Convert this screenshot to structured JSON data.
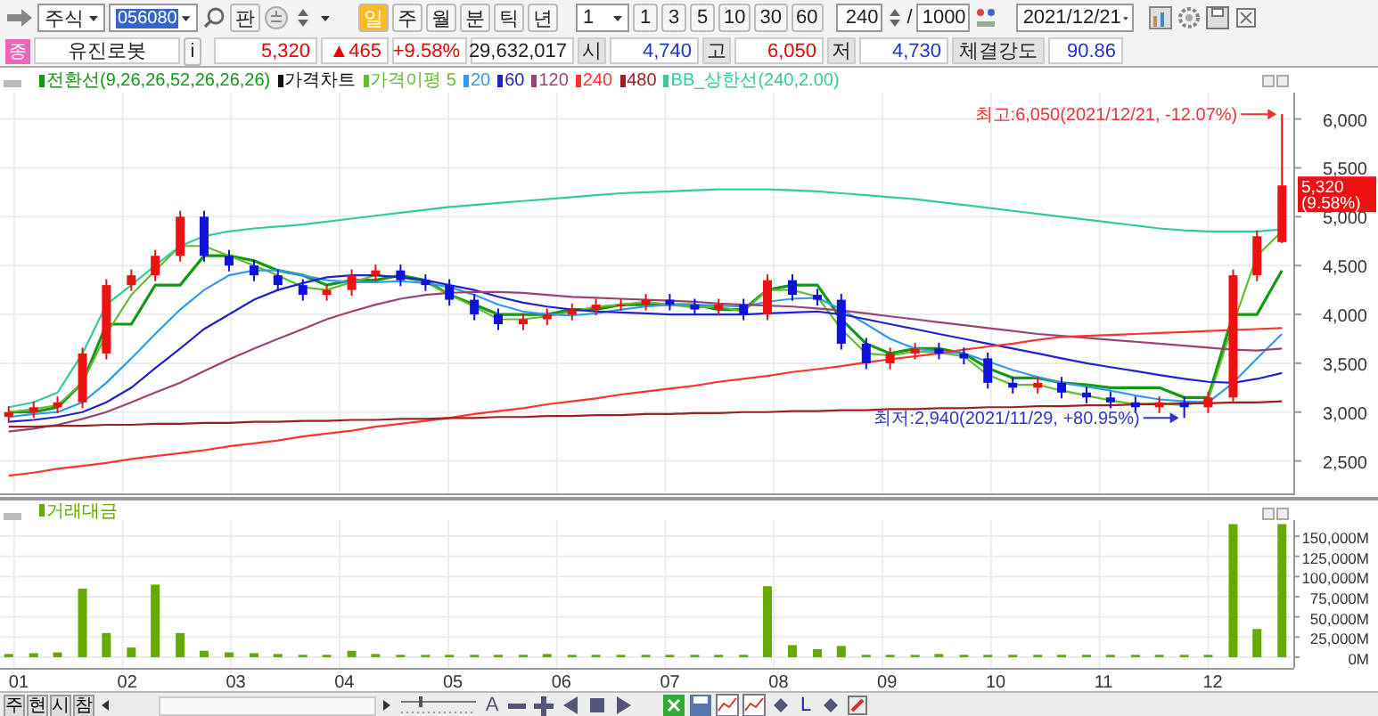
{
  "toolbar": {
    "market": "주식",
    "code": "056080",
    "chart_button": "판",
    "period_tabs": [
      {
        "label": "일",
        "selected": true
      },
      {
        "label": "주",
        "selected": false
      },
      {
        "label": "월",
        "selected": false
      },
      {
        "label": "분",
        "selected": false
      },
      {
        "label": "틱",
        "selected": false
      },
      {
        "label": "년",
        "selected": false
      }
    ],
    "interval": "1",
    "interval_buttons": [
      "1",
      "3",
      "5",
      "10",
      "30",
      "60"
    ],
    "count": "240",
    "separator": "/",
    "total": "1000",
    "date": "2021/12/21"
  },
  "quote": {
    "badge": "종",
    "name": "유진로봇",
    "info": "i",
    "price": "5,320",
    "change": "▲465",
    "rate": "+9.58%",
    "volume": "29,632,017",
    "fields": [
      {
        "label": "시",
        "value": "4,740",
        "color": "#2233cc"
      },
      {
        "label": "고",
        "value": "6,050",
        "color": "#ee0000"
      },
      {
        "label": "저",
        "value": "4,730",
        "color": "#2233cc"
      },
      {
        "label": "체결강도",
        "value": "90.86",
        "color": "#2233cc"
      }
    ]
  },
  "price_chart": {
    "candle_label": "가격차트",
    "last_price": "5,320",
    "last_rate": "(9.58%)",
    "chart_data": {
      "type": "candlestick",
      "grid": true,
      "x": [
        0.95,
        1.18,
        1.4,
        1.63,
        1.85,
        2.08,
        2.3,
        2.53,
        2.75,
        2.98,
        3.21,
        3.43,
        3.66,
        3.88,
        4.11,
        4.33,
        4.56,
        4.79,
        5.01,
        5.24,
        5.46,
        5.69,
        5.91,
        6.14,
        6.36,
        6.59,
        6.82,
        7.04,
        7.27,
        7.49,
        7.72,
        7.94,
        8.17,
        8.4,
        8.62,
        8.85,
        9.07,
        9.3,
        9.52,
        9.75,
        9.97,
        10.2,
        10.43,
        10.65,
        10.88,
        11.1,
        11.33,
        11.55,
        11.78,
        12.0,
        12.23,
        12.45,
        12.68
      ],
      "xlim": [
        0.87,
        12.76
      ],
      "ylim": [
        2150,
        6270
      ],
      "yticks": [
        {
          "value": 2500,
          "label": "2,500"
        },
        {
          "value": 3000,
          "label": "3,000"
        },
        {
          "value": 3500,
          "label": "3,500"
        },
        {
          "value": 4000,
          "label": "4,000"
        },
        {
          "value": 4500,
          "label": "4,500"
        },
        {
          "value": 5000,
          "label": "5,000"
        },
        {
          "value": 5500,
          "label": "5,500"
        },
        {
          "value": 6000,
          "label": "6,000"
        }
      ],
      "ohlc": [
        [
          2950,
          3060,
          2890,
          3000
        ],
        [
          3000,
          3110,
          2940,
          3050
        ],
        [
          3050,
          3160,
          2990,
          3100
        ],
        [
          3100,
          3660,
          3040,
          3600
        ],
        [
          3600,
          4360,
          3540,
          4300
        ],
        [
          4300,
          4460,
          4240,
          4400
        ],
        [
          4400,
          4660,
          4340,
          4600
        ],
        [
          4600,
          5060,
          4540,
          5000
        ],
        [
          5000,
          5060,
          4540,
          4600
        ],
        [
          4600,
          4660,
          4440,
          4500
        ],
        [
          4500,
          4560,
          4340,
          4400
        ],
        [
          4400,
          4460,
          4240,
          4300
        ],
        [
          4300,
          4360,
          4140,
          4200
        ],
        [
          4200,
          4310,
          4140,
          4250
        ],
        [
          4250,
          4460,
          4190,
          4400
        ],
        [
          4400,
          4510,
          4340,
          4450
        ],
        [
          4450,
          4510,
          4290,
          4350
        ],
        [
          4350,
          4410,
          4240,
          4300
        ],
        [
          4300,
          4360,
          4090,
          4150
        ],
        [
          4150,
          4210,
          3940,
          4000
        ],
        [
          4000,
          4060,
          3840,
          3900
        ],
        [
          3900,
          4010,
          3840,
          3950
        ],
        [
          3950,
          4060,
          3890,
          4000
        ],
        [
          4000,
          4110,
          3940,
          4050
        ],
        [
          4050,
          4160,
          3990,
          4100
        ],
        [
          4100,
          4160,
          4040,
          4100
        ],
        [
          4100,
          4210,
          4040,
          4150
        ],
        [
          4150,
          4210,
          4040,
          4100
        ],
        [
          4100,
          4160,
          3990,
          4050
        ],
        [
          4050,
          4160,
          3990,
          4100
        ],
        [
          4100,
          4160,
          3940,
          4000
        ],
        [
          4000,
          4410,
          3940,
          4350
        ],
        [
          4350,
          4410,
          4140,
          4200
        ],
        [
          4200,
          4260,
          4090,
          4150
        ],
        [
          4150,
          4210,
          3640,
          3700
        ],
        [
          3700,
          3760,
          3440,
          3500
        ],
        [
          3500,
          3660,
          3440,
          3600
        ],
        [
          3600,
          3710,
          3540,
          3650
        ],
        [
          3650,
          3710,
          3540,
          3600
        ],
        [
          3600,
          3660,
          3490,
          3550
        ],
        [
          3550,
          3610,
          3240,
          3300
        ],
        [
          3300,
          3360,
          3190,
          3250
        ],
        [
          3250,
          3360,
          3190,
          3300
        ],
        [
          3300,
          3360,
          3140,
          3200
        ],
        [
          3200,
          3260,
          3090,
          3150
        ],
        [
          3150,
          3210,
          3040,
          3100
        ],
        [
          3100,
          3160,
          2990,
          3050
        ],
        [
          3050,
          3160,
          2990,
          3100
        ],
        [
          3100,
          3160,
          2940,
          3050
        ],
        [
          3050,
          3210,
          2990,
          3150
        ],
        [
          3150,
          4460,
          3090,
          4400
        ],
        [
          4400,
          4860,
          4340,
          4800
        ],
        [
          4740,
          6050,
          4730,
          5320
        ]
      ],
      "series": [
        {
          "name": "전환선(9,26,26,52,26,26,26)",
          "type": "line",
          "color": "#119911",
          "values": [
            3000,
            3000,
            3050,
            3300,
            3900,
            3900,
            4300,
            4300,
            4600,
            4600,
            4550,
            4450,
            4400,
            4300,
            4350,
            4350,
            4400,
            4350,
            4200,
            4100,
            4000,
            4000,
            4000,
            4050,
            4050,
            4100,
            4100,
            4100,
            4100,
            4050,
            4050,
            4250,
            4300,
            4300,
            3950,
            3700,
            3600,
            3650,
            3650,
            3600,
            3450,
            3350,
            3350,
            3300,
            3280,
            3250,
            3250,
            3250,
            3150,
            3150,
            4000,
            4000,
            4450
          ]
        },
        {
          "name": "가격이평 5",
          "type": "line",
          "color": "#66bb33",
          "values": [
            3000,
            3030,
            3070,
            3300,
            3800,
            4200,
            4450,
            4700,
            4700,
            4600,
            4500,
            4400,
            4280,
            4250,
            4330,
            4400,
            4380,
            4330,
            4200,
            4080,
            3950,
            3950,
            3980,
            4030,
            4080,
            4100,
            4130,
            4100,
            4070,
            4080,
            4030,
            4250,
            4250,
            4180,
            3850,
            3600,
            3580,
            3620,
            3610,
            3570,
            3380,
            3280,
            3280,
            3220,
            3170,
            3120,
            3080,
            3090,
            3070,
            3120,
            3900,
            4600,
            4850
          ]
        },
        {
          "name": "20",
          "type": "line",
          "color": "#3399ee",
          "values": [
            2950,
            2980,
            3000,
            3100,
            3300,
            3550,
            3800,
            4050,
            4250,
            4400,
            4450,
            4450,
            4400,
            4350,
            4330,
            4330,
            4340,
            4320,
            4280,
            4200,
            4100,
            4030,
            4000,
            3990,
            4010,
            4050,
            4080,
            4100,
            4100,
            4090,
            4080,
            4130,
            4160,
            4170,
            4050,
            3900,
            3750,
            3650,
            3620,
            3600,
            3520,
            3430,
            3360,
            3300,
            3260,
            3220,
            3170,
            3130,
            3110,
            3100,
            3300,
            3550,
            3800
          ]
        },
        {
          "name": "60",
          "type": "line",
          "color": "#2222cc",
          "values": [
            2900,
            2920,
            2950,
            3000,
            3100,
            3250,
            3450,
            3650,
            3850,
            4000,
            4150,
            4250,
            4320,
            4380,
            4400,
            4400,
            4380,
            4350,
            4300,
            4250,
            4180,
            4120,
            4080,
            4050,
            4030,
            4020,
            4010,
            4000,
            4000,
            4000,
            4000,
            4010,
            4020,
            4030,
            4000,
            3950,
            3900,
            3850,
            3800,
            3750,
            3700,
            3650,
            3600,
            3550,
            3500,
            3460,
            3420,
            3380,
            3340,
            3310,
            3300,
            3340,
            3400
          ]
        },
        {
          "name": "120",
          "type": "line",
          "color": "#994477",
          "values": [
            2800,
            2830,
            2870,
            2930,
            3000,
            3100,
            3200,
            3300,
            3420,
            3540,
            3650,
            3750,
            3850,
            3950,
            4030,
            4100,
            4160,
            4200,
            4220,
            4230,
            4230,
            4220,
            4200,
            4180,
            4170,
            4160,
            4150,
            4140,
            4130,
            4110,
            4100,
            4090,
            4080,
            4060,
            4040,
            4010,
            3980,
            3950,
            3920,
            3890,
            3860,
            3830,
            3800,
            3780,
            3760,
            3740,
            3720,
            3700,
            3680,
            3660,
            3640,
            3630,
            3650
          ]
        },
        {
          "name": "240",
          "type": "line",
          "color": "#ff3333",
          "values": [
            2350,
            2380,
            2420,
            2450,
            2480,
            2520,
            2550,
            2580,
            2610,
            2650,
            2680,
            2710,
            2750,
            2780,
            2810,
            2850,
            2880,
            2910,
            2940,
            2980,
            3010,
            3040,
            3080,
            3110,
            3140,
            3180,
            3210,
            3240,
            3270,
            3310,
            3340,
            3370,
            3410,
            3440,
            3470,
            3510,
            3540,
            3570,
            3600,
            3640,
            3670,
            3700,
            3740,
            3770,
            3780,
            3790,
            3800,
            3810,
            3820,
            3830,
            3840,
            3850,
            3860
          ]
        },
        {
          "name": "480",
          "type": "line",
          "color": "#992222",
          "values": [
            2850,
            2850,
            2860,
            2860,
            2870,
            2870,
            2880,
            2880,
            2890,
            2890,
            2900,
            2900,
            2910,
            2910,
            2920,
            2920,
            2930,
            2930,
            2940,
            2940,
            2950,
            2950,
            2960,
            2960,
            2970,
            2970,
            2980,
            2980,
            2990,
            2990,
            3000,
            3000,
            3010,
            3010,
            3020,
            3020,
            3030,
            3030,
            3040,
            3040,
            3050,
            3050,
            3060,
            3060,
            3070,
            3070,
            3080,
            3080,
            3090,
            3090,
            3100,
            3100,
            3110
          ]
        },
        {
          "name": "BB_상한선(240,2.00)",
          "type": "line",
          "color": "#33cc99",
          "values": [
            3050,
            3100,
            3200,
            3600,
            4100,
            4300,
            4500,
            4700,
            4800,
            4850,
            4880,
            4900,
            4920,
            4950,
            4980,
            5010,
            5040,
            5070,
            5100,
            5120,
            5140,
            5160,
            5180,
            5200,
            5220,
            5240,
            5250,
            5260,
            5270,
            5280,
            5280,
            5280,
            5270,
            5260,
            5240,
            5220,
            5200,
            5180,
            5150,
            5120,
            5090,
            5060,
            5030,
            5000,
            4970,
            4940,
            4910,
            4880,
            4860,
            4850,
            4850,
            4850,
            4870
          ]
        }
      ],
      "annotations": [
        {
          "text": "최고:6,050(2021/12/21, -12.07%)",
          "x": 12.68,
          "y": 6050
        },
        {
          "text": "최저:2,940(2021/11/29, +80.95%)",
          "x": 11.78,
          "y": 2940
        }
      ]
    }
  },
  "volume_chart": {
    "chart_data": {
      "type": "bar",
      "grid": true,
      "x": [
        0.95,
        1.18,
        1.4,
        1.63,
        1.85,
        2.08,
        2.3,
        2.53,
        2.75,
        2.98,
        3.21,
        3.43,
        3.66,
        3.88,
        4.11,
        4.33,
        4.56,
        4.79,
        5.01,
        5.24,
        5.46,
        5.69,
        5.91,
        6.14,
        6.36,
        6.59,
        6.82,
        7.04,
        7.27,
        7.49,
        7.72,
        7.94,
        8.17,
        8.4,
        8.62,
        8.85,
        9.07,
        9.3,
        9.52,
        9.75,
        9.97,
        10.2,
        10.43,
        10.65,
        10.88,
        11.1,
        11.33,
        11.55,
        11.78,
        12.0,
        12.23,
        12.45,
        12.68
      ],
      "xlim": [
        0.87,
        12.76
      ],
      "xticks": [
        {
          "value": 1,
          "label": "01"
        },
        {
          "value": 2,
          "label": "02"
        },
        {
          "value": 3,
          "label": "03"
        },
        {
          "value": 4,
          "label": "04"
        },
        {
          "value": 5,
          "label": "05"
        },
        {
          "value": 6,
          "label": "06"
        },
        {
          "value": 7,
          "label": "07"
        },
        {
          "value": 8,
          "label": "08"
        },
        {
          "value": 9,
          "label": "09"
        },
        {
          "value": 10,
          "label": "10"
        },
        {
          "value": 11,
          "label": "11"
        },
        {
          "value": 12,
          "label": "12"
        }
      ],
      "ylim": [
        0,
        170000
      ],
      "yticks": [
        {
          "value": 0,
          "label": "0M"
        },
        {
          "value": 25000,
          "label": "25,000M"
        },
        {
          "value": 50000,
          "label": "50,000M"
        },
        {
          "value": 75000,
          "label": "75,000M"
        },
        {
          "value": 100000,
          "label": "100,000M"
        },
        {
          "value": 125000,
          "label": "125,000M"
        },
        {
          "value": 150000,
          "label": "150,000M"
        }
      ],
      "series": [
        {
          "name": "거래대금",
          "color": "#66aa00",
          "values": [
            4000,
            5000,
            6000,
            85000,
            30000,
            12000,
            90000,
            30000,
            8000,
            6000,
            5000,
            4000,
            3000,
            3000,
            8000,
            4000,
            3000,
            3000,
            3000,
            3000,
            3000,
            3000,
            4000,
            3000,
            3000,
            3000,
            3000,
            3000,
            3000,
            3000,
            3000,
            88000,
            15000,
            10000,
            14000,
            3000,
            3000,
            3000,
            4000,
            3000,
            3000,
            3000,
            3000,
            3000,
            3000,
            3000,
            3000,
            3000,
            3000,
            3000,
            165000,
            35000,
            165000
          ]
        }
      ]
    }
  },
  "bottom_tabs": [
    "주",
    "현",
    "시",
    "참"
  ],
  "bottom_tools": [
    {
      "kind": "text",
      "label": "A"
    },
    {
      "kind": "minus"
    },
    {
      "kind": "plus"
    },
    {
      "kind": "prev"
    },
    {
      "kind": "stop"
    },
    {
      "kind": "next"
    },
    {
      "kind": "excel"
    },
    {
      "kind": "save"
    },
    {
      "kind": "chart"
    },
    {
      "kind": "chart"
    },
    {
      "kind": "diamond"
    },
    {
      "kind": "text",
      "label": "L"
    },
    {
      "kind": "diamond"
    },
    {
      "kind": "tool"
    }
  ]
}
